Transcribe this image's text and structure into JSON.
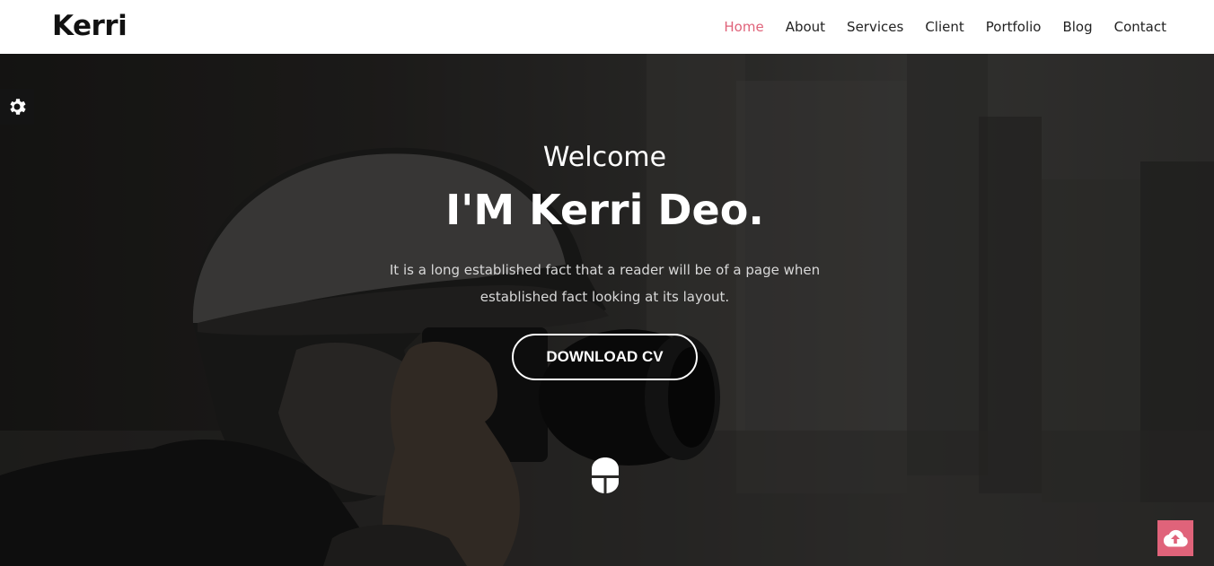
{
  "header": {
    "brand": "Kerri",
    "nav": [
      {
        "label": "Home",
        "active": true
      },
      {
        "label": "About",
        "active": false
      },
      {
        "label": "Services",
        "active": false
      },
      {
        "label": "Client",
        "active": false
      },
      {
        "label": "Portfolio",
        "active": false
      },
      {
        "label": "Blog",
        "active": false
      },
      {
        "label": "Contact",
        "active": false
      }
    ]
  },
  "hero": {
    "welcome": "Welcome",
    "headline": "I'M Kerri Deo.",
    "description": "It is a long established fact that a reader will be of a page when established fact looking at its layout.",
    "cta_label": "DOWNLOAD CV",
    "scroll_icon": "mouse-icon"
  },
  "widgets": {
    "settings_icon": "gear-icon",
    "back_to_top_icon": "cloud-upload-icon"
  },
  "colors": {
    "accent": "#e0637a",
    "nav_text": "#222222",
    "header_bg": "#ffffff"
  }
}
